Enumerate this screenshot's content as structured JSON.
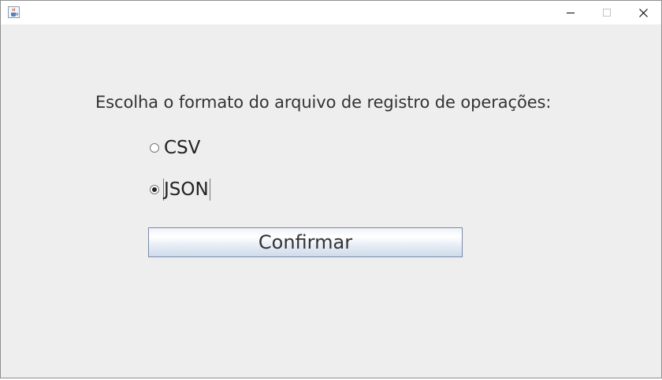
{
  "window": {
    "icon": "java-cup-icon",
    "controls": {
      "minimize": "minimize-icon",
      "maximize": "maximize-icon",
      "close": "close-icon"
    }
  },
  "prompt": "Escolha o formato do arquivo de registro de operações:",
  "options": [
    {
      "label": "CSV",
      "checked": false
    },
    {
      "label": "JSON",
      "checked": true
    }
  ],
  "confirm_button": "Confirmar",
  "colors": {
    "window_bg": "#eeeeee",
    "button_border": "#7a8aa6"
  }
}
